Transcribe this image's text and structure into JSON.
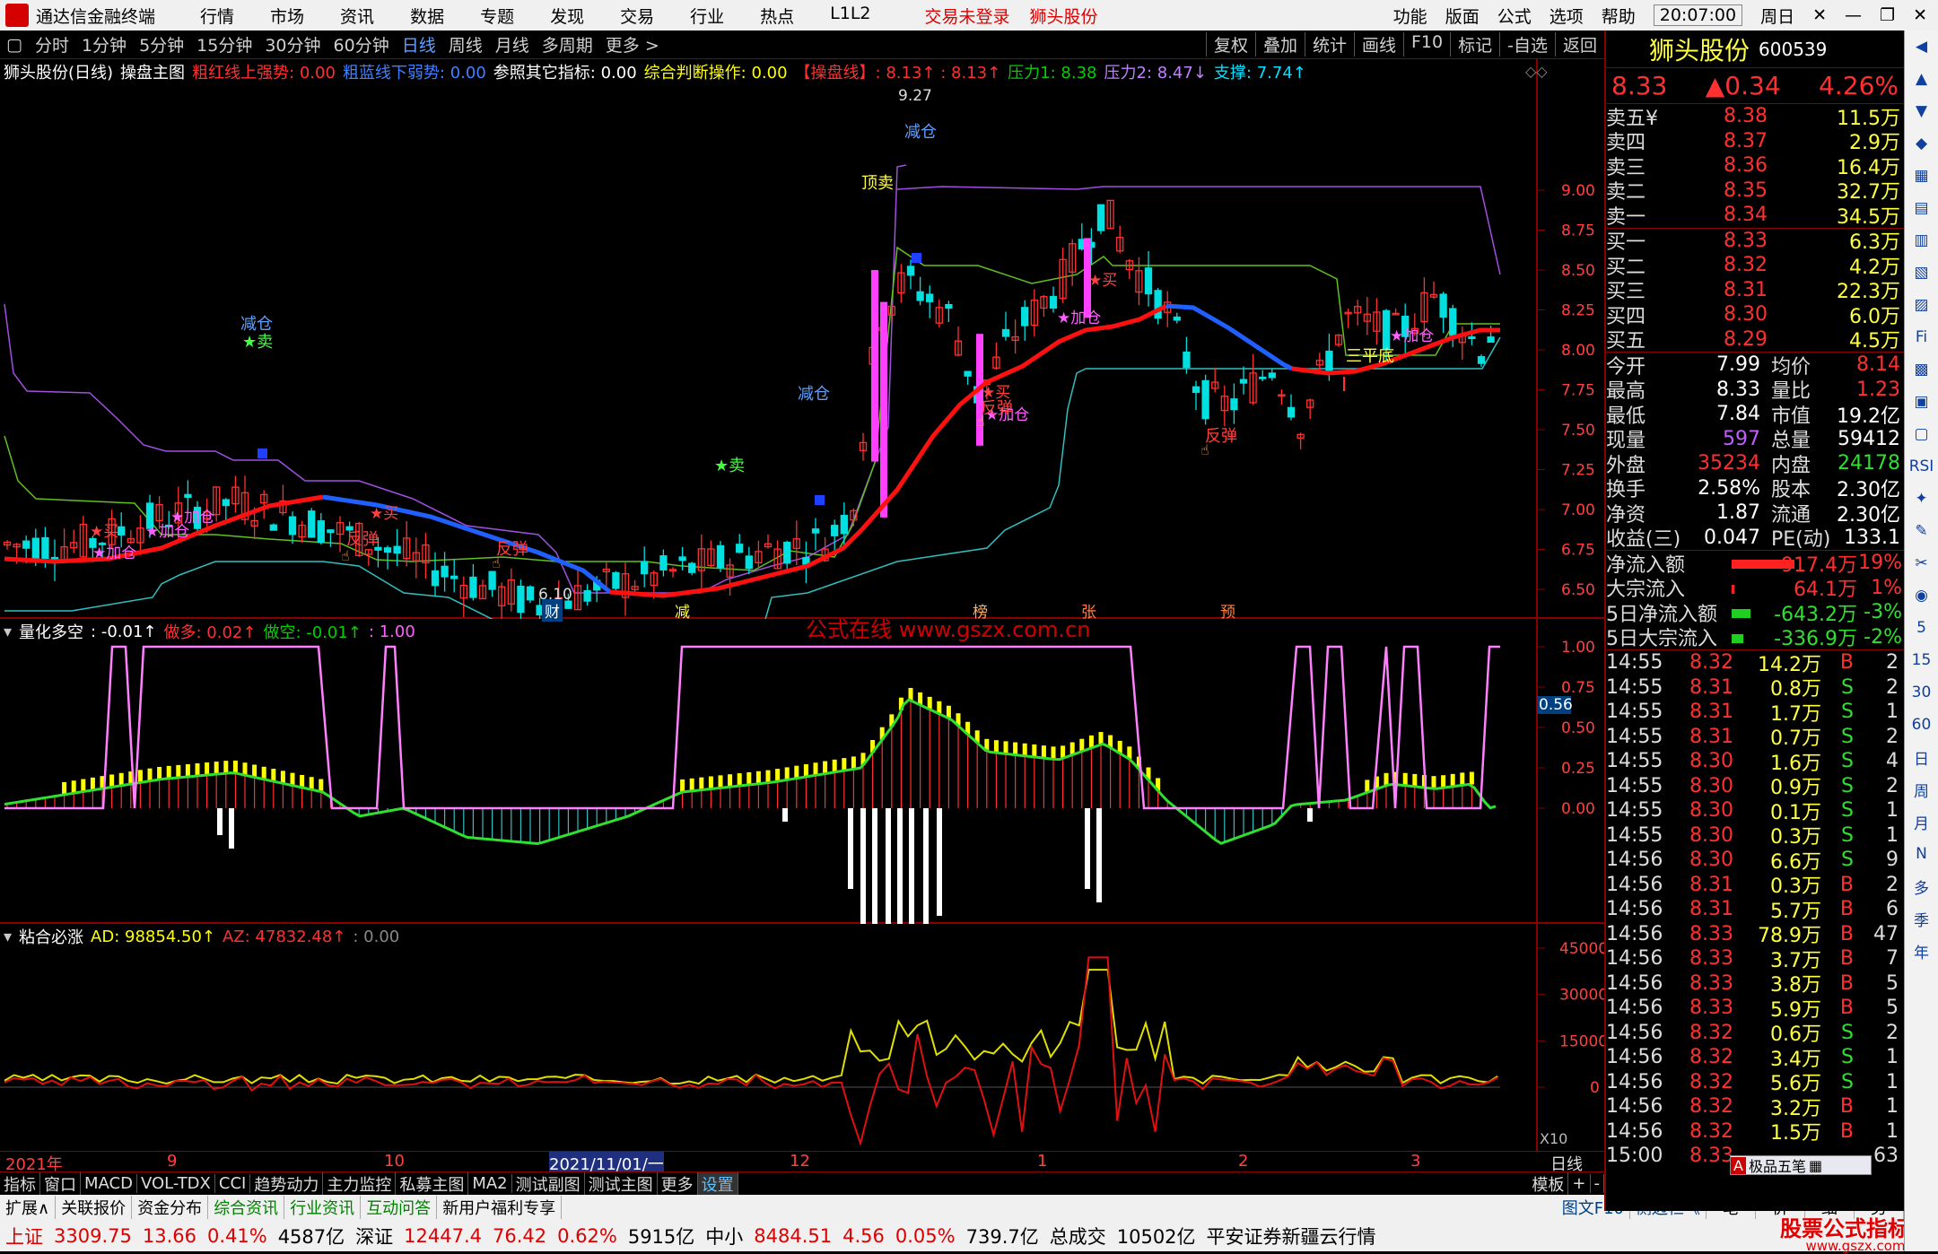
{
  "title_bar": {
    "app": "通达信金融终端",
    "menu": [
      "行情",
      "市场",
      "资讯",
      "数据",
      "专题",
      "发现",
      "交易",
      "行业",
      "热点",
      "L1L2"
    ],
    "red_links": [
      "交易未登录",
      "狮头股份"
    ],
    "right": [
      "功能",
      "版面",
      "公式",
      "选项",
      "帮助"
    ],
    "time": "20:07:00",
    "weekday": "周日"
  },
  "toolbar": {
    "periods": [
      "分时",
      "1分钟",
      "5分钟",
      "15分钟",
      "30分钟",
      "60分钟",
      "日线",
      "周线",
      "月线",
      "多周期",
      "更多 >"
    ],
    "selected": "日线",
    "right": [
      "复权",
      "叠加",
      "统计",
      "画线",
      "F10",
      "标记",
      "-自选",
      "返回"
    ]
  },
  "main": {
    "header": {
      "stock": "狮头股份(日线)",
      "formula": "操盘主图",
      "i1": "粗红线上强势: 0.00",
      "i2": "粗蓝线下弱势: 0.00",
      "i3": "参照其它指标: 0.00",
      "i4": "综合判断操作: 0.00",
      "i5": "【操盘线】: 8.13↑ : 8.13↑",
      "i6": "压力1: 8.38",
      "i7": "压力2: 8.47↓",
      "i8": "支撑: 7.74↑"
    },
    "y_ticks": [
      "9.00",
      "8.75",
      "8.50",
      "8.25",
      "8.00",
      "7.75",
      "7.50",
      "7.25",
      "7.00",
      "6.75",
      "6.50"
    ],
    "labels": {
      "max": "9.27",
      "min": "6.10",
      "jc1": "减仓",
      "jc2": "减仓",
      "jc3": "减仓",
      "sell": "★卖",
      "sell2": "★卖",
      "top": "顶卖",
      "buy": "★买",
      "add": "★加仓",
      "rebound": "反弹",
      "flat": "三平底"
    },
    "bottom_marks": [
      "财",
      "减",
      "榜",
      "张",
      "预"
    ],
    "watermark": "公式在线  www.gszx.com.cn"
  },
  "mid": {
    "header": {
      "name": "量化多空",
      "v1": ": -0.01↑",
      "v2": "做多: 0.02↑",
      "v3": "做空: -0.01↑",
      "v4": ": 1.00"
    },
    "y_ticks": [
      "1.00",
      "0.75",
      "0.50",
      "0.25",
      "0.00"
    ],
    "current": "0.56"
  },
  "low": {
    "header": {
      "name": "粘合必涨",
      "ad": "AD: 98854.50↑",
      "az": "AZ: 47832.48↑",
      "v": ": 0.00"
    },
    "y_ticks": [
      "45000",
      "30000",
      "15000",
      "0"
    ],
    "x10": "X10"
  },
  "date_axis": {
    "labels": [
      "2021年",
      "9",
      "10",
      "2021/11/01/一",
      "12",
      "1",
      "2",
      "3"
    ],
    "period": "日线"
  },
  "side": {
    "name": "狮头股份",
    "code": "600539",
    "price": "8.33",
    "change": "▲0.34",
    "pct": "4.26%",
    "asks": [
      [
        "卖五¥",
        "8.38",
        "11.5万"
      ],
      [
        "卖四",
        "8.37",
        "2.9万"
      ],
      [
        "卖三",
        "8.36",
        "16.4万"
      ],
      [
        "卖二",
        "8.35",
        "32.7万"
      ],
      [
        "卖一",
        "8.34",
        "34.5万"
      ]
    ],
    "bids": [
      [
        "买一",
        "8.33",
        "6.3万"
      ],
      [
        "买二",
        "8.32",
        "4.2万"
      ],
      [
        "买三",
        "8.31",
        "22.3万"
      ],
      [
        "买四",
        "8.30",
        "6.0万"
      ],
      [
        "买五",
        "8.29",
        "4.5万"
      ]
    ],
    "stats": [
      [
        "今开",
        "7.99",
        "均价",
        "8.14"
      ],
      [
        "最高",
        "8.33",
        "量比",
        "1.23"
      ],
      [
        "最低",
        "7.84",
        "市值",
        "19.2亿"
      ],
      [
        "现量",
        "597",
        "总量",
        "59412"
      ],
      [
        "外盘",
        "35234",
        "内盘",
        "24178"
      ],
      [
        "换手",
        "2.58%",
        "股本",
        "2.30亿"
      ],
      [
        "净资",
        "1.87",
        "流通",
        "2.30亿"
      ],
      [
        "收益(三)",
        "0.047",
        "PE(动)",
        "133.1"
      ]
    ],
    "flows": [
      [
        "净流入额",
        "917.4万",
        "19%"
      ],
      [
        "大宗流入",
        "64.1万",
        "1%"
      ],
      [
        "5日净流入额",
        "-643.2万",
        "-3%"
      ],
      [
        "5日大宗流入",
        "-336.9万",
        "-2%"
      ]
    ],
    "ticks": [
      [
        "14:55",
        "8.32",
        "14.2万",
        "B",
        "2"
      ],
      [
        "14:55",
        "8.31",
        "0.8万",
        "S",
        "2"
      ],
      [
        "14:55",
        "8.31",
        "1.7万",
        "S",
        "1"
      ],
      [
        "14:55",
        "8.31",
        "0.7万",
        "S",
        "2"
      ],
      [
        "14:55",
        "8.30",
        "1.6万",
        "S",
        "4"
      ],
      [
        "14:55",
        "8.30",
        "0.9万",
        "S",
        "2"
      ],
      [
        "14:55",
        "8.30",
        "0.1万",
        "S",
        "1"
      ],
      [
        "14:55",
        "8.30",
        "0.3万",
        "S",
        "1"
      ],
      [
        "14:56",
        "8.30",
        "6.6万",
        "S",
        "9"
      ],
      [
        "14:56",
        "8.31",
        "0.3万",
        "B",
        "2"
      ],
      [
        "14:56",
        "8.31",
        "5.7万",
        "B",
        "6"
      ],
      [
        "14:56",
        "8.33",
        "78.9万",
        "B",
        "47"
      ],
      [
        "14:56",
        "8.33",
        "3.7万",
        "B",
        "7"
      ],
      [
        "14:56",
        "8.33",
        "3.8万",
        "B",
        "5"
      ],
      [
        "14:56",
        "8.33",
        "5.9万",
        "B",
        "5"
      ],
      [
        "14:56",
        "8.32",
        "0.6万",
        "S",
        "2"
      ],
      [
        "14:56",
        "8.32",
        "3.4万",
        "S",
        "1"
      ],
      [
        "14:56",
        "8.32",
        "5.6万",
        "S",
        "1"
      ],
      [
        "14:56",
        "8.32",
        "3.2万",
        "B",
        "1"
      ],
      [
        "14:56",
        "8.32",
        "1.5万",
        "B",
        "1"
      ],
      [
        "15:00",
        "8.33",
        "",
        "",
        "63"
      ]
    ],
    "popup": "极品五笔"
  },
  "iconbar": [
    "◀",
    "▲",
    "▼",
    "◆",
    "▦",
    "▤",
    "▥",
    "▧",
    "▨",
    "Fi",
    "▩",
    "▣",
    "▢",
    "RSI",
    "✦",
    "✎",
    "✂",
    "◉",
    "5",
    "15",
    "30",
    "60",
    "日",
    "周",
    "月",
    "N",
    "多",
    "季",
    "年"
  ],
  "bottom_tabs": [
    "指标",
    "窗口",
    "MACD",
    "VOL-TDX",
    "CCI",
    "趋势动力",
    "主力监控",
    "私募主图",
    "MA2",
    "测试副图",
    "测试主图",
    "更多",
    "设置",
    "模板",
    "+",
    "-"
  ],
  "info_tabs": [
    "扩展∧",
    "关联报价",
    "资金分布",
    "综合资讯",
    "行业资讯",
    "互动问答",
    "新用户福利专享"
  ],
  "info_right": [
    "图文F10",
    "侧边栏《",
    "笔",
    "价",
    "细",
    "势"
  ],
  "status": {
    "sh": "上证",
    "sh_v": "3309.75",
    "sh_c": "13.66",
    "sh_p": "0.41%",
    "sh_a": "4587亿",
    "sz": "深证",
    "sz_v": "12447.4",
    "sz_c": "76.42",
    "sz_p": "0.62%",
    "sz_a": "5915亿",
    "zx": "中小",
    "zx_v": "8484.51",
    "zx_c": "4.56",
    "zx_p": "0.05%",
    "zx_a": "739.7亿",
    "total": "总成交",
    "total_v": "10502亿",
    "broker": "平安证券新疆云行情",
    "brand": "股票公式指标网",
    "brand_url": "www.gszx.com"
  },
  "colors": {
    "up": "#ff3030",
    "down": "#00e0e0",
    "magenta": "#ff40ff",
    "blue": "#2060ff",
    "yellow": "#ffff00",
    "green": "#00d000"
  }
}
